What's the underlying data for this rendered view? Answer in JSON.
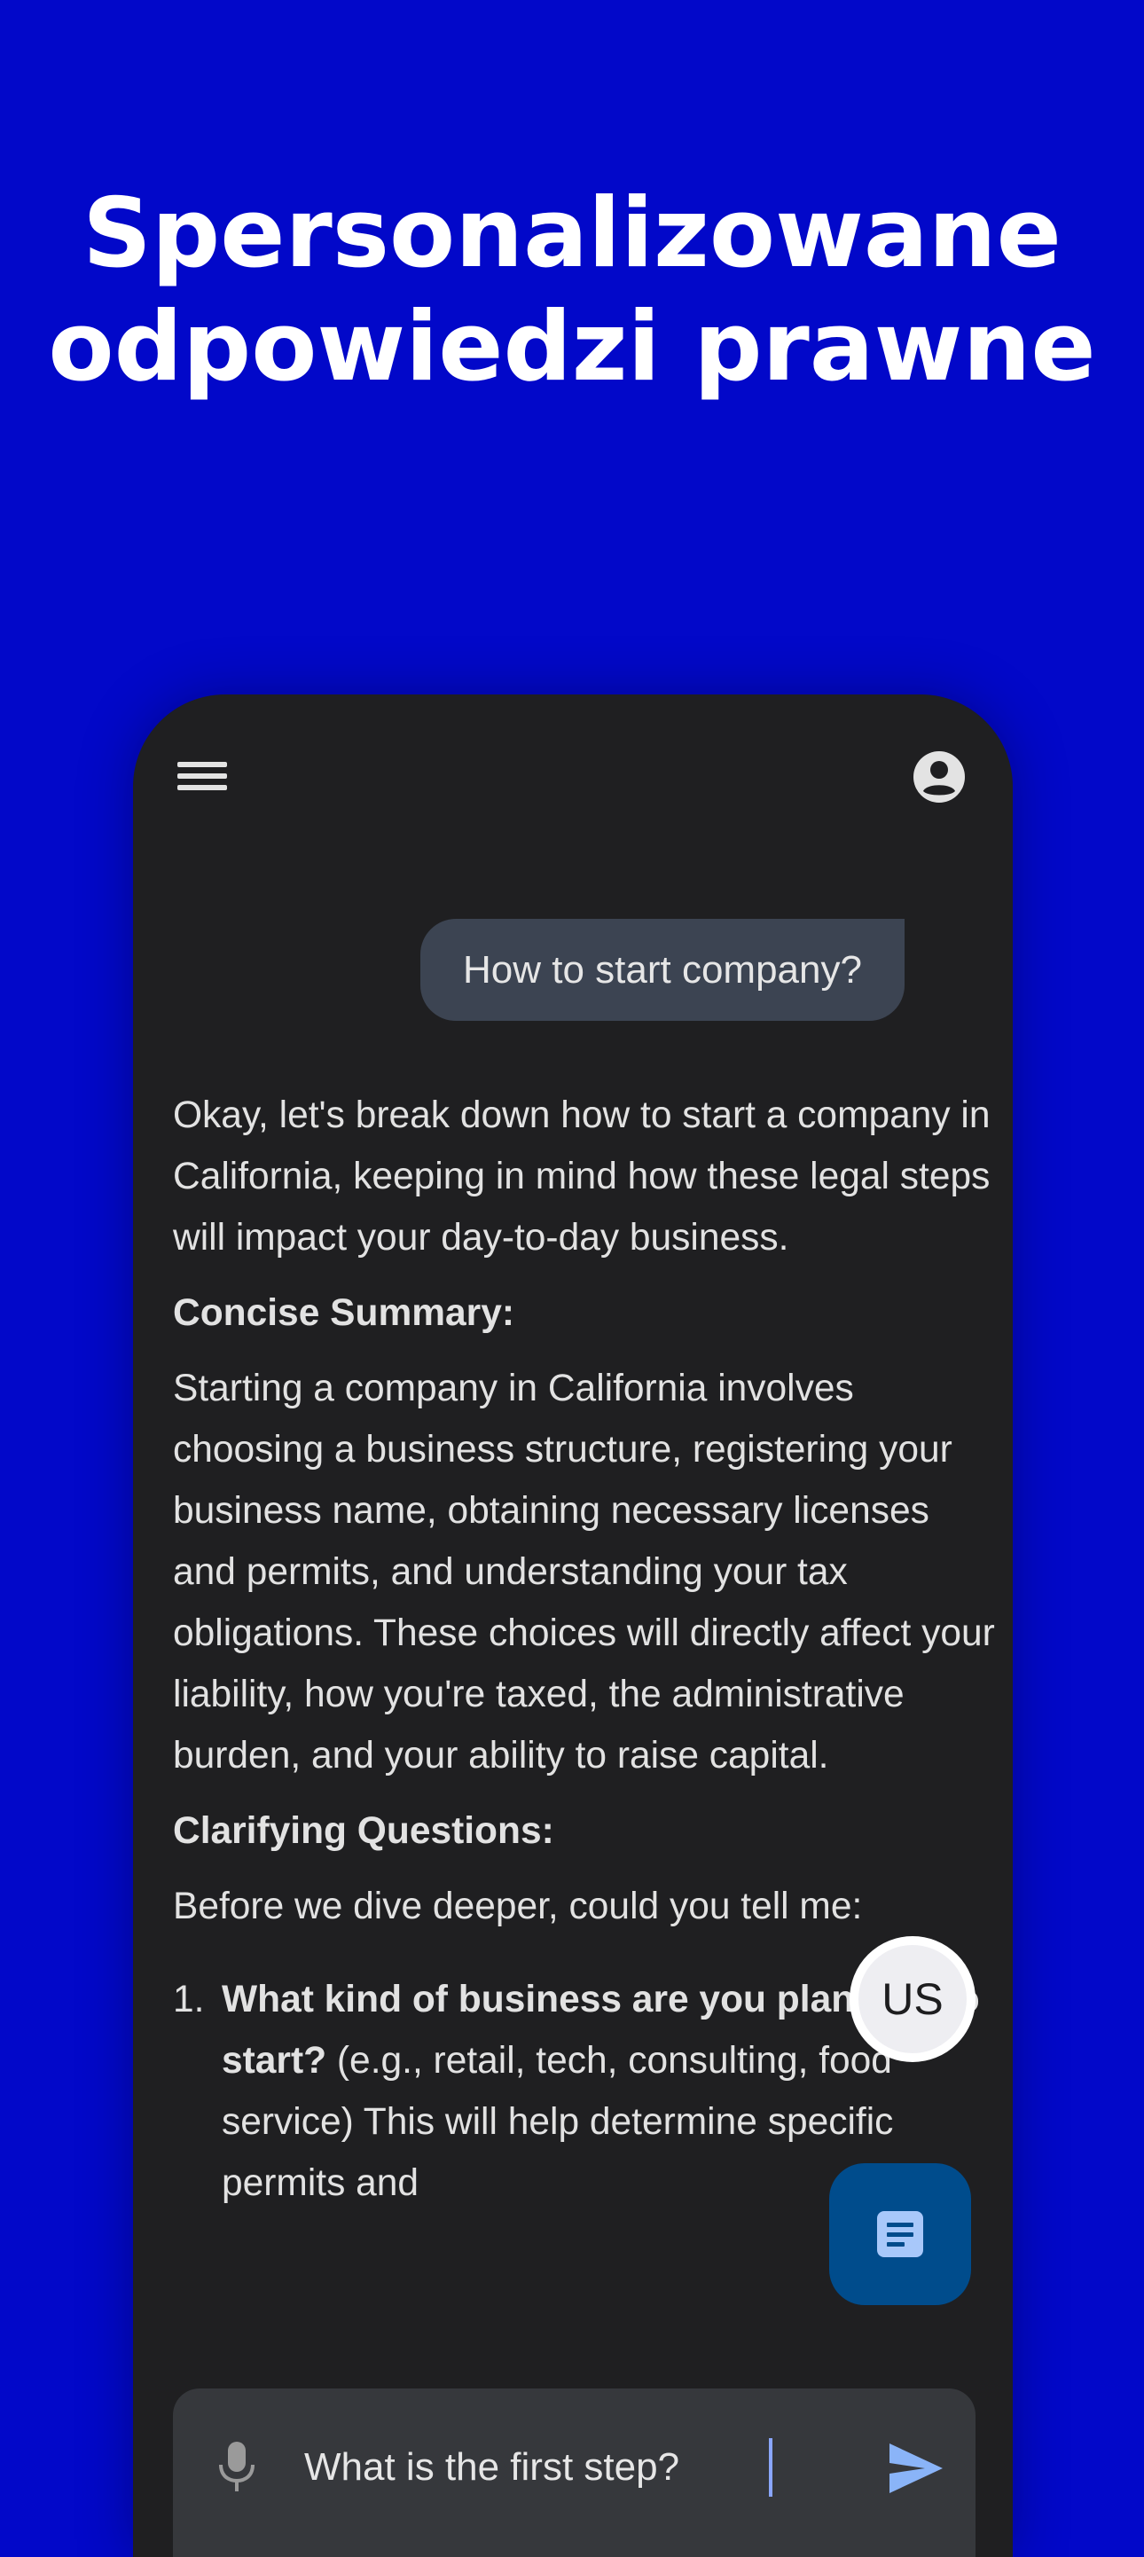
{
  "headline": "Spersonalizowane odpowiedzi prawne",
  "app": {
    "user_message": "How to start company?",
    "response": {
      "intro": "Okay, let's break down how to start a company in California, keeping in mind how these legal steps will impact your day-to-day business.",
      "summary_heading": "Concise Summary:",
      "summary_text": "Starting a company in California involves choosing a business structure, registering your business name, obtaining necessary licenses and permits, and understanding your tax obligations. These choices will directly affect your liability, how you're taxed, the administrative burden, and your ability to raise capital.",
      "questions_heading": "Clarifying Questions:",
      "questions_intro": "Before we dive deeper, could you tell me:",
      "questions": [
        {
          "number": "1.",
          "question": "What kind of business are you planning to start?",
          "detail": " (e.g., retail, tech, consulting, food service) This will help determine specific permits and"
        }
      ]
    },
    "country_fab_label": "US",
    "input": {
      "value": "What is the first step?"
    },
    "icons": {
      "menu": "menu-icon",
      "account": "account-circle-icon",
      "documents": "document-icon",
      "mic": "mic-icon",
      "send": "send-icon"
    },
    "colors": {
      "background": "#0208c9",
      "screen": "#1f1f21",
      "user_bubble": "#3c4452",
      "doc_fab": "#004c8c",
      "send": "#8ab4f8"
    }
  }
}
